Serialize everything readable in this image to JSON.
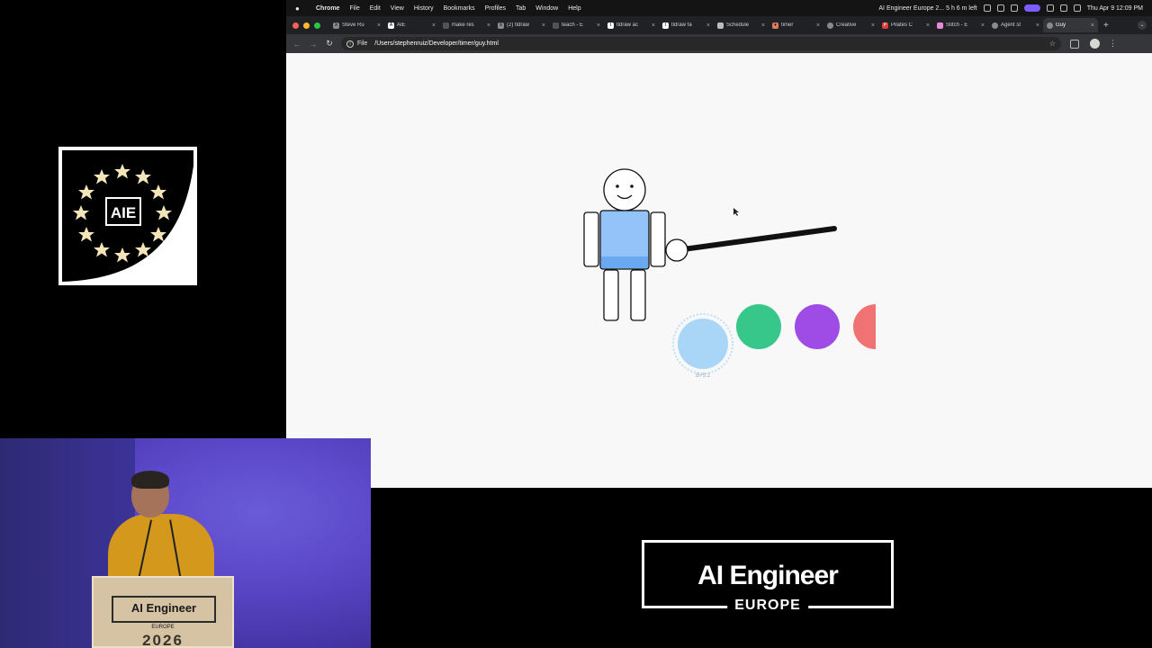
{
  "menubar": {
    "app": "Chrome",
    "items": [
      "File",
      "Edit",
      "View",
      "History",
      "Bookmarks",
      "Profiles",
      "Tab",
      "Window",
      "Help"
    ],
    "status_text": "AI Engineer Europe 2... 5 h 6 m left",
    "clock": "Thu Apr 9  12:09 PM"
  },
  "tabs": [
    {
      "label": "Steve Ru",
      "icon": "x-logo-icon"
    },
    {
      "label": "AIE",
      "icon": "aie-icon"
    },
    {
      "label": "make res",
      "icon": "dots-icon"
    },
    {
      "label": "(2) tldraw",
      "icon": "x-logo-icon"
    },
    {
      "label": "teach - E",
      "icon": "dots-icon"
    },
    {
      "label": "tldraw ac",
      "icon": "tldraw-icon"
    },
    {
      "label": "tldraw fa",
      "icon": "tldraw-icon"
    },
    {
      "label": "Schedule",
      "icon": "calendar-icon"
    },
    {
      "label": "timer",
      "icon": "triangle-icon"
    },
    {
      "label": "Creative",
      "icon": "globe-icon"
    },
    {
      "label": "Pilates C",
      "icon": "p-icon"
    },
    {
      "label": "Stitch - E",
      "icon": "stitch-icon"
    },
    {
      "label": "Agent st",
      "icon": "globe-icon"
    },
    {
      "label": "Guy",
      "icon": "globe-icon",
      "active": true
    }
  ],
  "address": {
    "scheme": "File",
    "url": "/Users/stephenruiz/Developer/timer/guy.html"
  },
  "canvas": {
    "circle_label": "B+5:2",
    "balls": [
      {
        "name": "light-blue-ball",
        "color": "#a9d6f7"
      },
      {
        "name": "green-ball",
        "color": "#38c78a"
      },
      {
        "name": "purple-ball",
        "color": "#9f4be6"
      },
      {
        "name": "red-ball",
        "color": "#f07272"
      }
    ],
    "figure_shirt_color": "#93c3f8",
    "figure_shirt_hem_color": "#6aa8f2"
  },
  "branding": {
    "badge_text": "AIE",
    "brand_name": "AI Engineer",
    "brand_region": "EUROPE",
    "podium_name": "AI Engineer",
    "podium_region": "EUROPE",
    "podium_year": "2026"
  }
}
